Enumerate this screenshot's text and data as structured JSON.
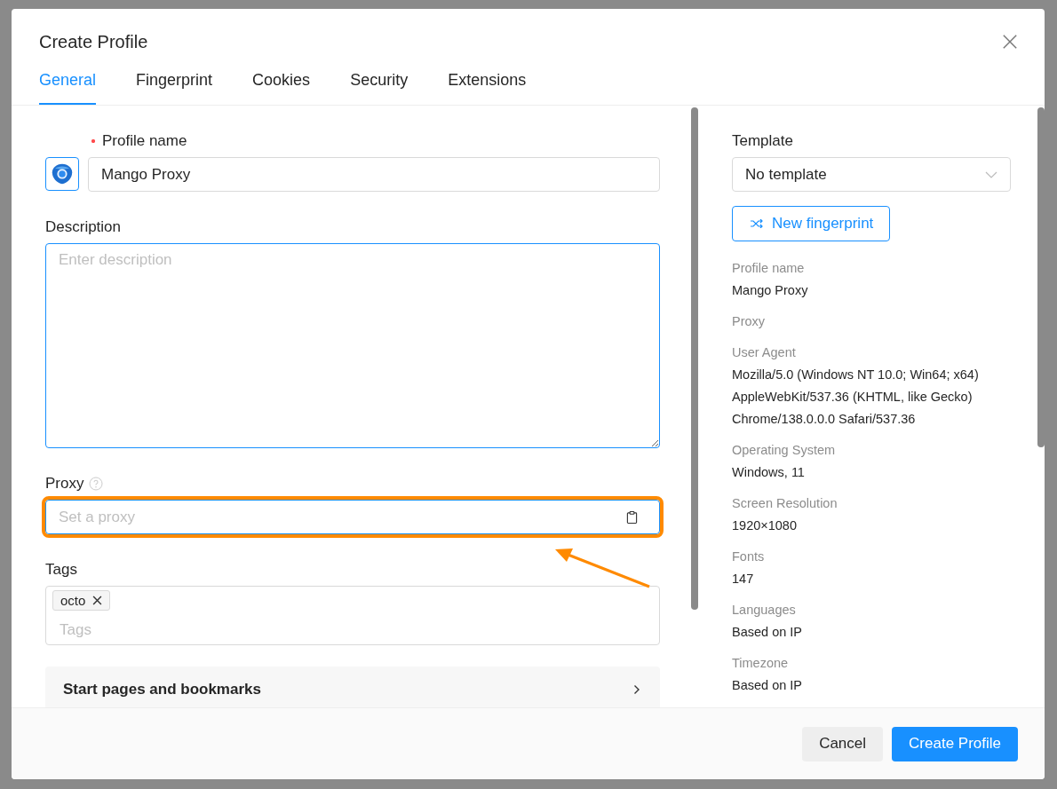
{
  "dialog": {
    "title": "Create Profile"
  },
  "tabs": [
    {
      "label": "General",
      "selected": true
    },
    {
      "label": "Fingerprint",
      "selected": false
    },
    {
      "label": "Cookies",
      "selected": false
    },
    {
      "label": "Security",
      "selected": false
    },
    {
      "label": "Extensions",
      "selected": false
    }
  ],
  "form": {
    "profile_name": {
      "label": "Profile name",
      "required": true,
      "value": "Mango Proxy"
    },
    "description": {
      "label": "Description",
      "placeholder": "Enter description"
    },
    "proxy": {
      "label": "Proxy",
      "placeholder": "Set a proxy",
      "highlighted": true
    },
    "tags": {
      "label": "Tags",
      "placeholder": "Tags",
      "items": [
        "octo"
      ]
    },
    "section": {
      "label": "Start pages and bookmarks"
    }
  },
  "side": {
    "template": {
      "label": "Template",
      "value": "No template"
    },
    "button": "New fingerprint",
    "details": [
      {
        "label": "Profile name",
        "value": "Mango Proxy"
      },
      {
        "label": "Proxy"
      },
      {
        "label": "User Agent",
        "value": "Mozilla/5.0 (Windows NT 10.0; Win64; x64) AppleWebKit/537.36 (KHTML, like Gecko) Chrome/138.0.0.0 Safari/537.36"
      },
      {
        "label": "Operating System",
        "value": "Windows, 11"
      },
      {
        "label": "Screen Resolution",
        "value": "1920×1080"
      },
      {
        "label": "Fonts",
        "value": "147"
      },
      {
        "label": "Languages",
        "value": "Based on IP"
      },
      {
        "label": "Timezone",
        "value": "Based on IP"
      }
    ]
  },
  "footer": {
    "buttons": [
      {
        "label": "Cancel",
        "kind": "secondary"
      },
      {
        "label": "Create Profile",
        "kind": "primary"
      }
    ]
  }
}
